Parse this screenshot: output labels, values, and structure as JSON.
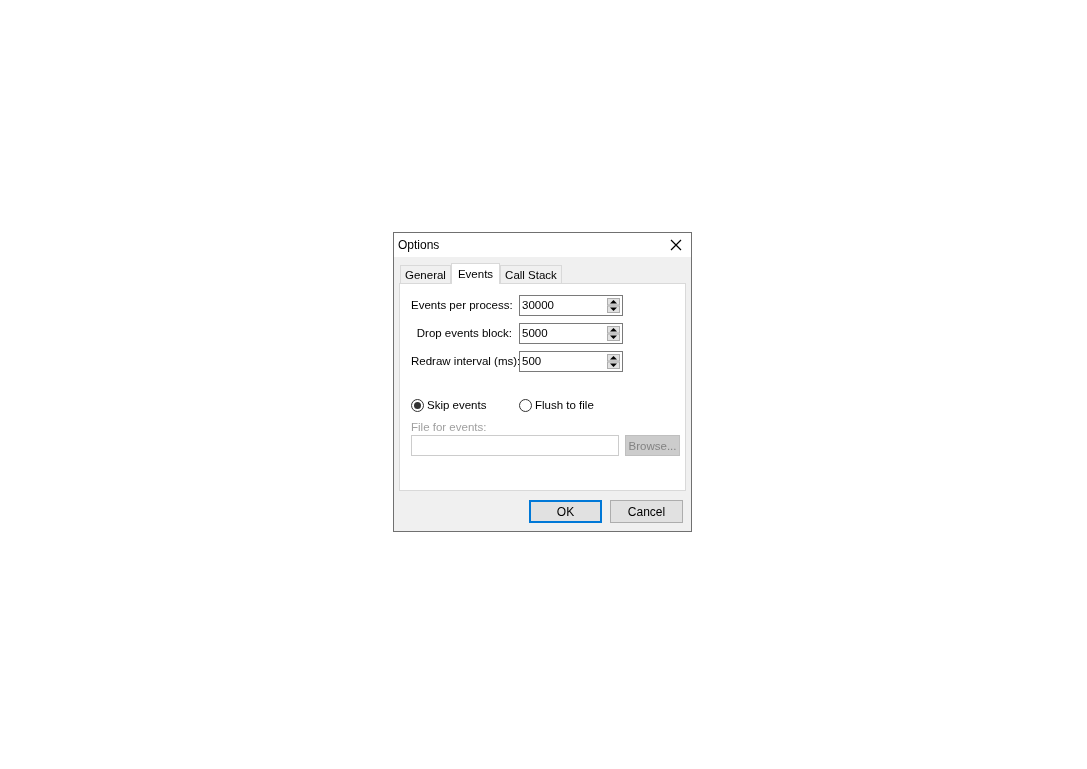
{
  "window": {
    "title": "Options"
  },
  "tabs": [
    {
      "label": "General",
      "selected": false
    },
    {
      "label": "Events",
      "selected": true
    },
    {
      "label": "Call Stack",
      "selected": false
    }
  ],
  "fields": [
    {
      "label": "Events per process:",
      "value": "30000"
    },
    {
      "label": "Drop events block:",
      "value": "5000"
    },
    {
      "label": "Redraw interval (ms):",
      "value": "500"
    }
  ],
  "radios": [
    {
      "label": "Skip events",
      "selected": true
    },
    {
      "label": "Flush to file",
      "selected": false
    }
  ],
  "file_field": {
    "label": "File for events:",
    "disabled": true
  },
  "browse_button": {
    "label": "Browse...",
    "disabled": true
  },
  "buttons": [
    {
      "label": "OK",
      "default": true
    },
    {
      "label": "Cancel",
      "default": false
    }
  ]
}
